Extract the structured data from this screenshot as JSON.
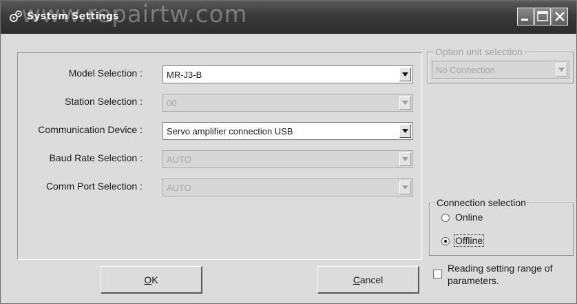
{
  "window": {
    "title": "System Settings",
    "watermark": "www.repairtw.com"
  },
  "form": {
    "model_label": "Model Selection :",
    "model_value": "MR-J3-B",
    "station_label": "Station Selection :",
    "station_value": "00",
    "comm_device_label": "Communication Device :",
    "comm_device_value": "Servo amplifier connection USB",
    "baud_label": "Baud Rate Selection :",
    "baud_value": "AUTO",
    "port_label": "Comm Port Selection :",
    "port_value": "AUTO"
  },
  "option_unit": {
    "title": "Option unit selection",
    "value": "No Connection"
  },
  "connection": {
    "title": "Connection selection",
    "online_label": "Online",
    "offline_label": "Offline",
    "selected": "Offline"
  },
  "reading_range": {
    "label": "Reading setting range of parameters.",
    "checked": false
  },
  "buttons": {
    "ok_mnemonic": "O",
    "ok_rest": "K",
    "cancel_mnemonic": "C",
    "cancel_rest": "ancel"
  }
}
